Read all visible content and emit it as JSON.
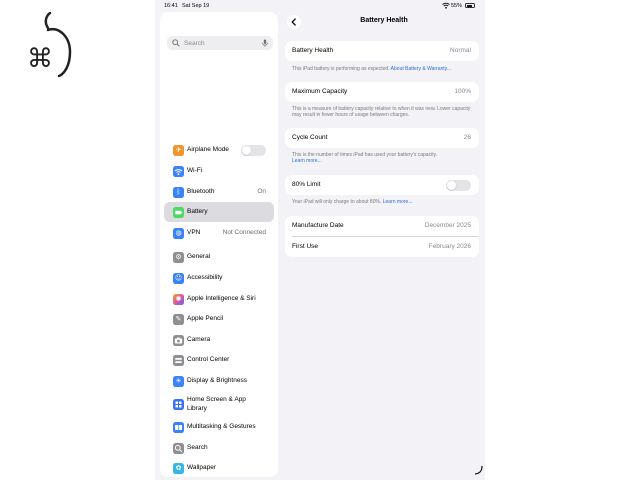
{
  "status_bar": {
    "time": "16:41",
    "date": "Sat Sep 19",
    "battery": "55%"
  },
  "sidebar": {
    "search_placeholder": "Search",
    "items": [
      {
        "label": "Airplane Mode",
        "icon": "airplane-icon",
        "color": "#f0962e",
        "toggle": true,
        "toggle_on": false
      },
      {
        "label": "Wi-Fi",
        "icon": "wifi-icon",
        "color": "#3a82f7"
      },
      {
        "label": "Bluetooth",
        "value": "On",
        "icon": "bluetooth-icon",
        "color": "#3a82f7"
      },
      {
        "label": "Battery",
        "icon": "battery-icon",
        "color": "#4cd964",
        "selected": true
      },
      {
        "label": "VPN",
        "value": "Not Connected",
        "icon": "vpn-icon",
        "color": "#3a82f7"
      },
      {
        "label": "General",
        "icon": "gear-icon",
        "color": "#8e8e93"
      },
      {
        "label": "Accessibility",
        "icon": "accessibility-icon",
        "color": "#3a82f7"
      },
      {
        "label": "Apple Intelligence & Siri",
        "icon": "siri-icon",
        "color": "#d95b9c"
      },
      {
        "label": "Apple Pencil",
        "icon": "pencil-icon",
        "color": "#8e8e93"
      },
      {
        "label": "Camera",
        "icon": "camera-icon",
        "color": "#8e8e93"
      },
      {
        "label": "Control Center",
        "icon": "control-center-icon",
        "color": "#8e8e93"
      },
      {
        "label": "Display & Brightness",
        "icon": "display-icon",
        "color": "#3a82f7"
      },
      {
        "label": "Home Screen & App Library",
        "icon": "home-screen-icon",
        "color": "#3a6ff7"
      },
      {
        "label": "Multitasking & Gestures",
        "icon": "multitasking-icon",
        "color": "#3a82f7"
      },
      {
        "label": "Search",
        "icon": "search-icon",
        "color": "#8e8e93"
      },
      {
        "label": "Wallpaper",
        "icon": "wallpaper-icon",
        "color": "#35b6e6"
      }
    ]
  },
  "detail": {
    "title": "Battery Health",
    "health": {
      "label": "Battery Health",
      "value": "Normal",
      "note": "This iPad battery is performing as expected.",
      "link": "About Battery & Warranty..."
    },
    "capacity": {
      "label": "Maximum Capacity",
      "value": "100%",
      "note": "This is a measure of battery capacity relative to when it was new. Lower capacity may result in fewer hours of usage between charges."
    },
    "cycles": {
      "label": "Cycle Count",
      "value": "26",
      "note": "This is the number of times iPad has used your battery's capacity.",
      "link": "Learn more..."
    },
    "limit": {
      "label": "80% Limit",
      "toggle_on": false,
      "note": "Your iPad will only charge to about 80%.",
      "link": "Learn more..."
    },
    "dates": [
      {
        "label": "Manufacture Date",
        "value": "December 2025"
      },
      {
        "label": "First Use",
        "value": "February 2026"
      }
    ]
  }
}
